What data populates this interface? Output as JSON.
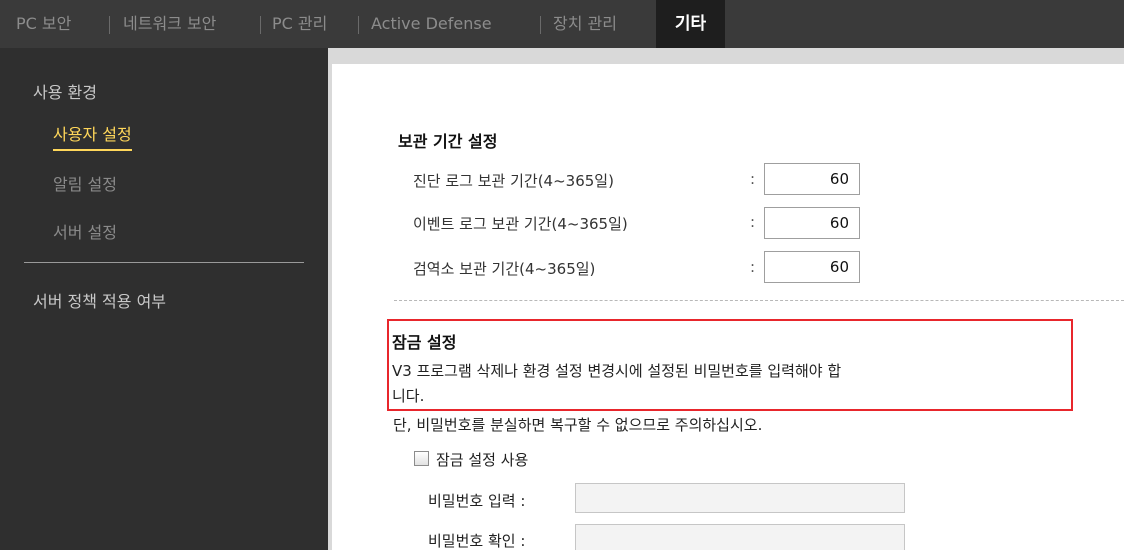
{
  "tabs": [
    {
      "label": "PC 보안"
    },
    {
      "label": "네트워크 보안"
    },
    {
      "label": "PC 관리"
    },
    {
      "label": "Active Defense"
    },
    {
      "label": "장치 관리"
    },
    {
      "label": "기타",
      "active": true
    }
  ],
  "sidebar": {
    "group1": "사용 환경",
    "items": [
      {
        "label": "사용자 설정",
        "selected": true
      },
      {
        "label": "알림 설정"
      },
      {
        "label": "서버 설정"
      }
    ],
    "group2": "서버 정책 적용 여부"
  },
  "retention": {
    "title": "보관 기간 설정",
    "rows": [
      {
        "label": "진단 로그 보관 기간(4~365일)",
        "value": "60"
      },
      {
        "label": "이벤트 로그 보관 기간(4~365일)",
        "value": "60"
      },
      {
        "label": "검역소 보관 기간(4~365일)",
        "value": "60"
      }
    ],
    "colon": ":"
  },
  "lock": {
    "title": "잠금 설정",
    "desc_line1": "V3 프로그램 삭제나 환경 설정 변경시에 설정된 비밀번호를 입력해야 합",
    "desc_line2": "니다.",
    "warning": "단, 비밀번호를 분실하면 복구할 수 없으므로 주의하십시오.",
    "checkbox_label": "잠금 설정 사용",
    "pw_label": "비밀번호 입력 :",
    "pw_confirm_label": "비밀번호 확인 :"
  },
  "colors": {
    "highlight": "#e8262c",
    "selected_item": "#ffd75a"
  }
}
